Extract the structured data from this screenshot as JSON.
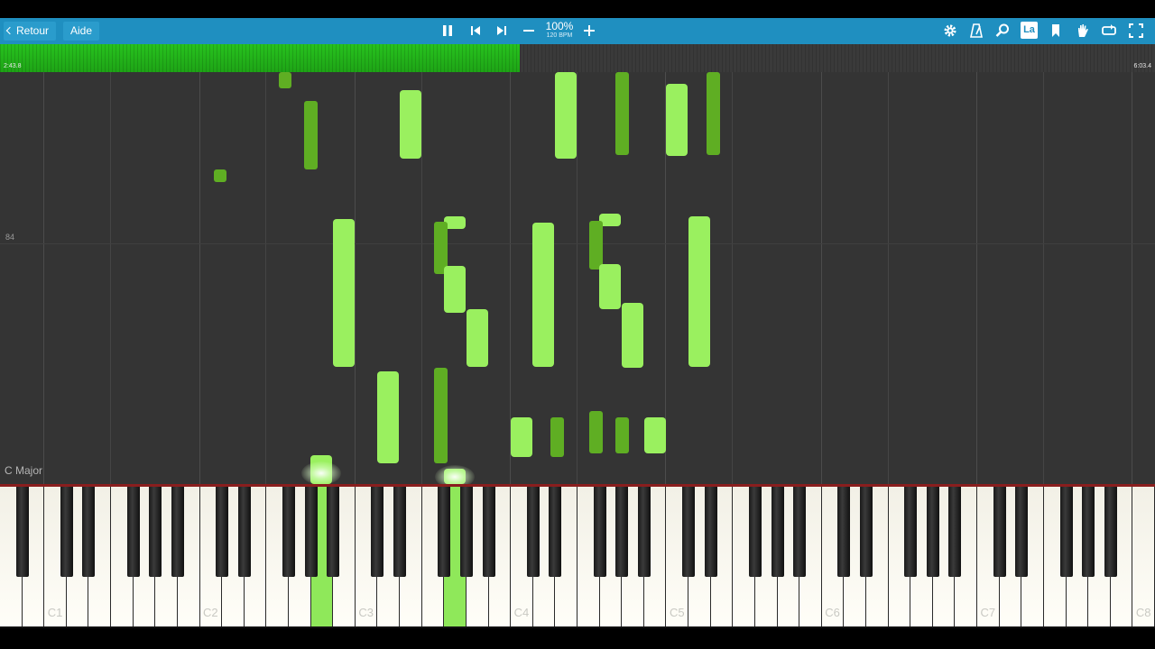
{
  "toolbar": {
    "back_label": "Retour",
    "help_label": "Aide",
    "speed_percent": "100%",
    "bpm": "120 BPM",
    "label_toggle": "La",
    "icons": [
      "pause-icon",
      "skip-back-icon",
      "skip-forward-icon",
      "minus-icon",
      "plus-icon",
      "gear-icon",
      "metronome-icon",
      "magnifier-icon",
      "label-icon",
      "bookmark-icon",
      "hand-icon",
      "loop-icon",
      "fullscreen-icon"
    ]
  },
  "progress": {
    "elapsed": "2:43.8",
    "total": "6:03.4",
    "fraction": 0.45,
    "fill_color": "#22b51a"
  },
  "roll": {
    "tempo_marker": "84",
    "key_signature": "C Major",
    "left_hand_color": "#9af05f",
    "right_hand_color": "#5fae23"
  },
  "piano": {
    "octave_labels": [
      "C1",
      "C2",
      "C3",
      "C4",
      "C5",
      "C6",
      "C7",
      "C8"
    ],
    "active_color": "#8fe85a"
  }
}
